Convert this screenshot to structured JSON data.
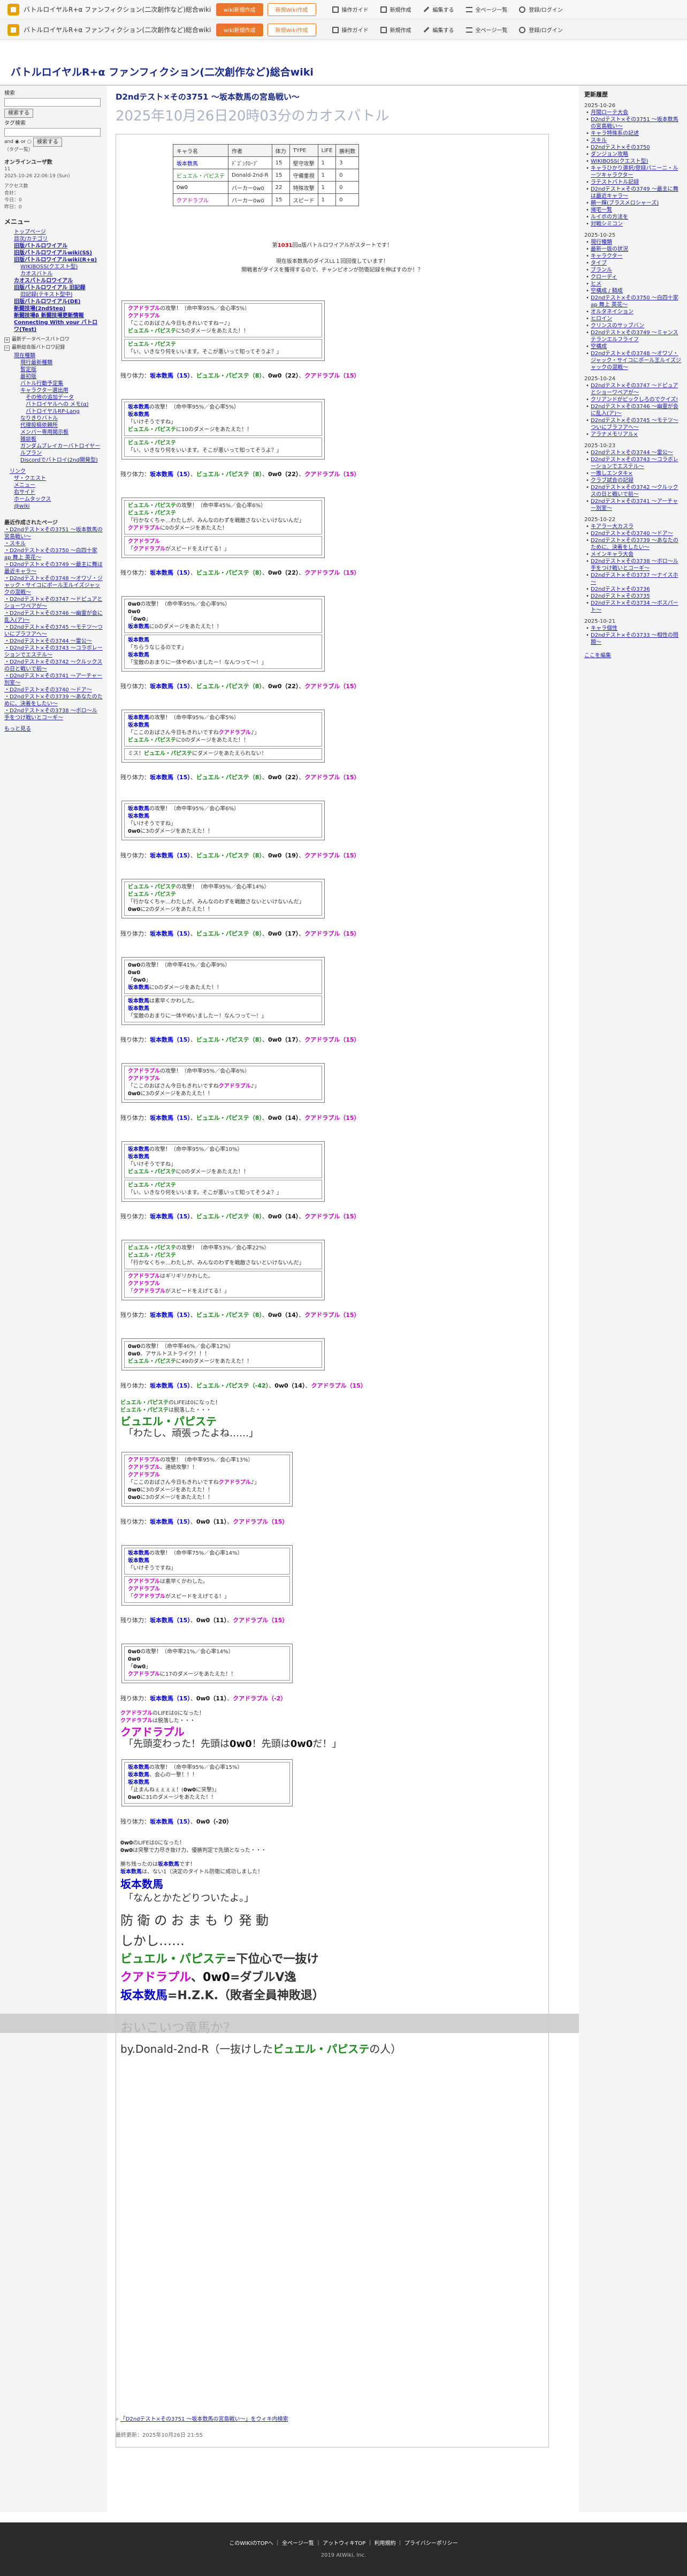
{
  "topbar": {
    "title": "バトルロイヤルR+α ファンフィクション(二次創作など)総合wiki",
    "btn_edit": "wiki新規作成",
    "btn_new": "新規Wiki作成",
    "items": [
      "操作ガイド",
      "新規作成",
      "編集する",
      "全ページ一覧",
      "登録/ログイン"
    ]
  },
  "site_title": "バトルロイヤルR+α ファンフィクション(二次創作など)総合wiki",
  "page": {
    "title": "D2ndテスト×その3751 ～坂本数馬の宮島戦い～",
    "subtitle": "2025年10月26日20時03分のカオスバトル"
  },
  "left": {
    "search_label": "検索",
    "search_btn": "検索する",
    "tag_label": "タグ検索",
    "tag_btn": "検索する",
    "and": "and",
    "or": "or",
    "tag_list": "（タグ一覧）",
    "online": "オンラインユーザ数",
    "online_val": "11",
    "counter_date": "2025-10-26 22:06:19 (Sun)",
    "counter_label": "アクセス数",
    "total": "合計：",
    "today": "今日：0",
    "yesterday": "昨日：0",
    "menu": "メニュー",
    "menu_items": [
      {
        "t": "トップページ",
        "c": "lb-ind1"
      },
      {
        "t": "目次/カテゴリ",
        "c": "lb-ind1"
      },
      {
        "t": "旧版バトルロワイアル",
        "c": "lb-ind1 b"
      },
      {
        "t": "旧版バトルロワイアルwiki(SS)",
        "c": "lb-ind1 b"
      },
      {
        "t": "旧版バトルロワイアルwiki(R+α)",
        "c": "lb-ind1 b"
      },
      {
        "t": "WIKIBOSS(クエスト型)",
        "c": "lb-ind2"
      },
      {
        "t": "カオスバトル",
        "c": "lb-ind2"
      },
      {
        "t": "カオスバトルロワイアル",
        "c": "lb-ind1 b"
      },
      {
        "t": "旧版バトルロワイアル 旧記録",
        "c": "lb-ind1 b"
      },
      {
        "t": "旧記録(テキスト型中)",
        "c": "lb-ind2"
      },
      {
        "t": "旧版バトルロワイアル(DE)",
        "c": "lb-ind1 b"
      },
      {
        "t": "新闘技場(2ndStep)",
        "c": "lb-ind1 b"
      },
      {
        "t": "新闘技場β 新闘技場更新情報",
        "c": "lb-ind1 b"
      },
      {
        "t": "Connecting With your バトロワ(Test)",
        "c": "lb-ind1 b"
      }
    ],
    "toggle1": "最新データベースバトロワ",
    "toggle2": "最新総合版バトロワ記録",
    "sub_items": [
      {
        "t": "現在種類",
        "c": "lb-ind1"
      },
      {
        "t": "現行最新種類",
        "c": "lb-ind2"
      },
      {
        "t": "暫定版",
        "c": "lb-ind2"
      },
      {
        "t": "最初版",
        "c": "lb-ind2"
      },
      {
        "t": "バトル行動予定集",
        "c": "lb-ind2"
      },
      {
        "t": "キャラクター選出用",
        "c": "lb-ind2"
      },
      {
        "t": "その他の追加データ",
        "c": "lb-ind3"
      },
      {
        "t": "バトロイヤルヘの メモ(α)",
        "c": "lb-ind3"
      },
      {
        "t": "バトロイヤルRP-Lang",
        "c": "lb-ind3"
      },
      {
        "t": "なりきりバトル",
        "c": "lb-ind2"
      },
      {
        "t": "代理投稿依頼所",
        "c": "lb-ind2"
      },
      {
        "t": "メンバー専用掲示板",
        "c": "lb-ind2"
      },
      {
        "t": "雑談板",
        "c": "lb-ind2"
      },
      {
        "t": "ガンダムブレイカーバトロイヤールプラン",
        "c": "lb-ind2"
      },
      {
        "t": "Discordでバトロイ(2nd開発型)",
        "c": "lb-ind2"
      }
    ],
    "links_h": "リンク",
    "link_items": [
      "ザ・クエスト",
      "メニュー",
      "右サイド",
      "ホームタックス",
      "@wiki"
    ],
    "recent_h": "最近作成されたページ",
    "recent": [
      "D2ndテスト×その3751 ～坂本数馬の宮島戦い～",
      "スキル",
      "D2ndテスト×その3750 ～白四十家 ap 舞上 英花～",
      "D2ndテスト×その3749 ～最主に舞は最近キャラ～",
      "D2ndテスト×その3748 ～オワゾ・ジャック・サイコにポール王ルイズジャックの混戦～",
      "D2ndテスト×その3747 ～ドピュアとショーワペアが～",
      "D2ndテスト×その3746 ～幽霊が会に乱入(ア)～",
      "D2ndテスト×その3745 ～モテツ～ついにブラフアヘ～",
      "D2ndテスト×その3744 ～雷公～",
      "D2ndテスト×その3743 ～コラボレーションでエステル～",
      "D2ndテスト×その3742 ～クルックスの日と戦いで前～",
      "D2ndテスト×その3741 ～アーチャー別室～",
      "D2ndテスト×その3740 ～ドア～",
      "D2ndテスト×その3739 ～あなたのために、決着をしたい～",
      "D2ndテスト×その3738 ～ボロ～ル 手をつけ戦いとコーギ～"
    ],
    "more": "もっと見る"
  },
  "table": {
    "headers": [
      "キャラ名",
      "作者",
      "体力",
      "TYPE",
      "LIFE",
      "勝利数"
    ],
    "rows": [
      [
        "坂本数馬",
        "ﾃﾞｺﾞﾝｸﾛｰﾌﾞ",
        "15",
        "堅守攻撃",
        "1",
        "3"
      ],
      [
        "ビュエル・パピステ",
        "Donald-2nd-R",
        "15",
        "守備重視",
        "1",
        "0"
      ],
      [
        "0w0",
        "バーカー0w0",
        "22",
        "特殊攻撃",
        "1",
        "0"
      ],
      [
        "クアドラプル",
        "バーカー0w0",
        "15",
        "スピード",
        "1",
        "0"
      ]
    ]
  },
  "intro": {
    "l1a": "第",
    "l1b": "1031",
    "l1c": "回α版バトルロワイアルがスタートです！",
    "l2": "現在坂本数馬のダイスLL１回回復しています！",
    "l3": "開戦者がダイスを獲得するので、チャンピオンが防衛記録を伸ばすのか！？"
  },
  "turns": [
    {
      "boxes": [
        [
          "クアドラプルの攻撃！（命中率95%／会心率5%）",
          "クアドラプル",
          "「ここのおばさん今日もきれいですねー♪」",
          "ビュエル・パピステに5のダメージをあたえた！！"
        ],
        [
          "ビュエル・パピステ",
          "「い、いきなり何をいいます。そこが悪いって知ってそうよ？」"
        ]
      ],
      "rem": [
        15,
        8,
        22,
        15
      ]
    },
    {
      "boxes": [
        [
          "坂本数馬の攻撃！（命中率95%／会心率5%）",
          "坂本数馬",
          "「いけそうですね」",
          "ビュエル・パピステに10のダメージをあたえた！！"
        ],
        [
          "ビュエル・パピステ",
          "「い、いきなり何をいいます。そこが悪いって知ってそうよ？」"
        ]
      ],
      "rem": [
        15,
        8,
        22,
        15
      ]
    },
    {
      "boxes": [
        [
          "ビュエル・パピステの攻撃！（命中率45%／会心率6%）",
          "ビュエル・パピステ",
          "「行かなくちゃ…わたしが、みんなのわずを戦敵さないといけないんだ」",
          "クアドラプルに0のダメージをあたえた！"
        ],
        [
          "クアドラプル",
          "「クアドラプルがスピードをえげてる！」"
        ]
      ],
      "rem": [
        15,
        8,
        22,
        15
      ]
    },
    {
      "boxes": [
        [
          "0w0の攻撃！（命中率95%／会心率9%）",
          "0w0",
          "「0w0」",
          "坂本数馬に0のダメージをあたえた！！"
        ],
        [
          "坂本数馬",
          "「ちらうなじるのです」",
          "坂本数馬",
          "「宝敵のおまりに一体やめいましたー！なんつって〜！」"
        ]
      ],
      "rem": [
        15,
        8,
        22,
        15
      ]
    },
    {
      "boxes": [
        [
          "坂本数馬の攻撃！（命中率95%／会心率5%）",
          "坂本数馬",
          "「ここのおばさん今日もきれいですねクアドラプル♪」",
          "ビュエル・パピステに0のダメージをあたえた！！"
        ],
        [
          "ミス！ビュエル・パピステにダメージをあたえられない！"
        ]
      ],
      "rem": [
        15,
        8,
        22,
        15
      ]
    },
    {
      "boxes": [
        [
          "坂本数馬の攻撃！（命中率95%／会心率6%）",
          "坂本数馬",
          "「いけそうですね」",
          "0w0に3のダメージをあたえた！！"
        ]
      ],
      "rem": [
        15,
        8,
        19,
        15
      ]
    },
    {
      "boxes": [
        [
          "ビュエル・パピステの攻撃！（命中率95%／会心率14%）",
          "ビュエル・パピステ",
          "「行かなくちゃ…わたしが、みんなのわずを戦敵さないといけないんだ」",
          "0w0に2のダメージをあたえた！！"
        ]
      ],
      "rem": [
        15,
        8,
        17,
        15
      ]
    },
    {
      "boxes": [
        [
          "0w0の攻撃！（命中率41%／会心率9%）",
          "0w0",
          "「0w0」",
          "坂本数馬に0のダメージをあたえた！！"
        ],
        [
          "坂本数馬は素早くかわした。",
          "坂本数馬",
          "「宝敵のおまりに一体やめいましたー！なんつって〜！」"
        ]
      ],
      "rem": [
        15,
        8,
        17,
        15
      ]
    },
    {
      "boxes": [
        [
          "クアドラプルの攻撃！（命中率95%／会心率6%）",
          "クアドラプル",
          "「ここのおばさん今日もきれいですねクアドラプル♪」",
          "0w0に3のダメージをあたえた！！"
        ]
      ],
      "rem": [
        15,
        8,
        14,
        15
      ]
    },
    {
      "boxes": [
        [
          "坂本数馬の攻撃！（命中率95%／会心率10%）",
          "坂本数馬",
          "「いけそうですね」",
          "ビュエル・パピステに0のダメージをあたえた！！"
        ],
        [
          "ビュエル・パピステ",
          "「い、いきなり何をいいます。そこが悪いって知ってそうよ？」"
        ]
      ],
      "rem": [
        15,
        8,
        14,
        15
      ]
    },
    {
      "boxes": [
        [
          "ビュエル・パピステの攻撃！（命中率53%／会心率22%）",
          "ビュエル・パピステ",
          "「行かなくちゃ…わたしが、みんなのわずを戦敵さないといけないんだ」"
        ],
        [
          "クアドラプルはギリギリかわした。",
          "クアドラプル",
          "「クアドラプルがスピードをえげてる！」"
        ]
      ],
      "rem": [
        15,
        8,
        14,
        15
      ]
    },
    {
      "boxes": [
        [
          "0w0の攻撃！（命中率46%／会心率12%）",
          "0w0、アサルトストライク！！！",
          "ビュエル・パピステに49のダメージをあたえた！！"
        ]
      ],
      "rem": [
        15,
        -42,
        14,
        15
      ]
    }
  ],
  "lines": {
    "rem_label": "残り体力：",
    "death1": "ビュエル・パピステのLIFEは0になった！",
    "death2": "ビュエル・パピステは脱落した・・・",
    "big_name": "ビュエル・パピステ",
    "big_quote": "「わたし、頑張ったよね……」"
  },
  "turns2": [
    {
      "boxes": [
        [
          "クアドラプルの攻撃！（命中率95%／会心率13%）",
          "クアドラプル、連続攻撃！！",
          "クアドラプル",
          "「ここのおばさん今日もきれいですねクアドラプル♪」",
          "0w0に3のダメージをあたえた！！",
          "0w0に3のダメージをあたえた！！"
        ]
      ],
      "rem": [
        15,
        11,
        15
      ]
    },
    {
      "boxes": [
        [
          "坂本数馬の攻撃！（命中率75%／会心率14%）",
          "坂本数馬",
          "「いけそうですね」"
        ],
        [
          "クアドラプルは素早くかわした。",
          "クアドラプル",
          "「クアドラプルがスピードをえげてる！」"
        ]
      ],
      "rem": [
        15,
        11,
        15
      ]
    },
    {
      "boxes": [
        [
          "0w0の攻撃！（命中率21%／会心率14%）",
          "0w0",
          "「0w0」",
          "クアドラプルに17のダメージをあたえた！！"
        ]
      ],
      "rem": [
        15,
        11,
        -2
      ]
    }
  ],
  "death_q": {
    "d1": "クアドラプルのLIFEは0になった！",
    "d2": "クアドラプルは脱落した・・・",
    "big_name": "クアドラプル",
    "big_quote": "「先頭変わった！先頭は0w0！先頭は0w0だ！」"
  },
  "final_box": [
    "坂本数馬の攻撃！（命中率95%／会心率15%）",
    "坂本数馬、会心の一撃！！！",
    "坂本数馬",
    "「止まんねぇぇぇぇ！(0w0に突撃)」",
    "0w0に31のダメージをあたえた！！"
  ],
  "final_rem": [
    15,
    -20
  ],
  "end": {
    "e1": "0w0のLIFEは0になった！",
    "e2": "0w0は突撃で力尽き抜け力、優勝判定で先頭となった・・・",
    "e3": "勝ち残ったのは坂本数馬です！",
    "e4": "坂本数馬は、ない1（決定のタイトル防衛に成功しました！",
    "big1": "坂本数馬",
    "big2": "「なんとかたどりついたよ。」",
    "big3": "防 衛 の お ま も り 発 動",
    "big4": "しかし……",
    "big5a": "ビュエル・パピステ",
    "big5b": "=下位心で一抜け",
    "big6a": "クアドラプル",
    "big6b": "、",
    "big6c": "0w0",
    "big6d": "=ダブルV逸",
    "big7": "坂本数馬=H.Z.K.（敗者全員神敗退）",
    "big8": "おいこいつ竜馬か？",
    "big9a": "by.Donald-2nd-R（一抜けしたビュエル・パピステの人）"
  },
  "right": {
    "h": "更新履歴",
    "groups": [
      {
        "d": "2025-10-26",
        "items": [
          "月間ローテ大会",
          "D2ndテスト×その3751 ～坂本数馬の宮島戦い～",
          "キャラ特殊系の記述",
          "スキル",
          "D2ndテスト×その3750",
          "ダンジョン攻略",
          "WIKIBOSS(クエスト型)",
          "キャラひかり選択/登録パニーニ・ルーツキャラクター",
          "ラテストバトル記録",
          "D2ndテスト×その3749 ～最主に舞は最近キャラ～",
          "頼一輝(ブラスメロシャーズ)",
          "帰宅一覧",
          "ルイボの方法を",
          "対戦シミコン"
        ]
      },
      {
        "d": "2025-10-25",
        "items": [
          "現行種類",
          "最新一版の状況",
          "キャラクター",
          "タイプ",
          "ブランル",
          "クローディ",
          "ヒメ",
          "空構成 / 騎成",
          "D2ndテスト×その3750 ～白四十家 ap 舞上 英花～",
          "オルタネイション",
          "ヒロイン",
          "クリンスのサッブバン",
          "D2ndテスト×その3749 ～ミャンステランエルフライフ",
          "空構成",
          "D2ndテスト×その3748 ～オワゾ・ジャック・サイコにポール王ルイズジャックの混戦～"
        ]
      },
      {
        "d": "2025-10-24",
        "items": [
          "D2ndテスト×その3747 ～ドピュアとショーワペアが～",
          "クリアンドがピックしろのでクイズ!",
          "D2ndテスト×その3746 ～幽霊が会に乱入(ア)～",
          "D2ndテスト×その3745 ～モテツ～ついにブラフアヘ～",
          "アラナメモリアル×"
        ]
      },
      {
        "d": "2025-10-23",
        "items": [
          "D2ndテスト×その3744 ～雷公～",
          "D2ndテスト×その3743 ～コラボレーションでエステル～",
          "一推しエンタキ×",
          "クラブ試合の記録",
          "D2ndテスト×その3742 ～クルックスの日と戦いで前～",
          "D2ndテスト×その3741 ～アーチャー別室～"
        ]
      },
      {
        "d": "2025-10-22",
        "items": [
          "キアラー大カスラ",
          "D2ndテスト×その3740 ～ドア～",
          "D2ndテスト×その3739 ～あなたのために、決着をしたい～",
          "メインキャラ大会",
          "D2ndテスト×その3738 ～ボロ～ル 手をつけ戦いとコーギ～",
          "D2ndテスト×その3737 ～ナイスホ～",
          "D2ndテスト×その3736",
          "D2ndテスト×その3735",
          "D2ndテスト×その3734 ～ボスパート～"
        ]
      },
      {
        "d": "2025-10-21",
        "items": [
          "キャラ個性",
          "D2ndテスト×その3733 ～相性の問題～"
        ]
      }
    ],
    "more": "ここを編集"
  },
  "foot": {
    "link": "「D2ndテスト×その3751 ～坂本数馬の宮島戦い～」をウィキ内検索",
    "updated": "最終更新：2025年10月26日 21:55"
  },
  "footer": {
    "links": "このWIKIのTOPへ ｜ 全ページ一覧 ｜ アットウィキTOP ｜ 利用規約 ｜ プライバシーポリシー",
    "copy": "2019 AtWiki, Inc."
  }
}
